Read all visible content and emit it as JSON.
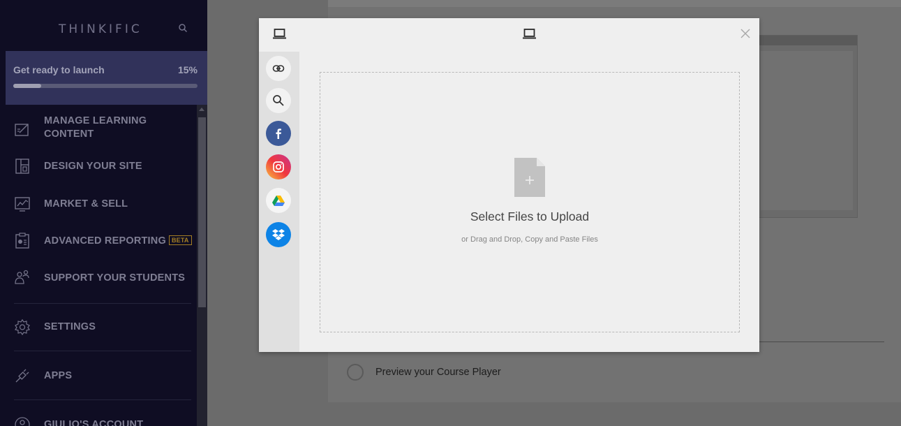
{
  "sidebar": {
    "logo": "THINKIFIC",
    "search_icon": "search-icon",
    "launch": {
      "label": "Get ready to launch",
      "percent_text": "15%",
      "progress": 0.15
    },
    "items": [
      {
        "label_line1": "MANAGE LEARNING",
        "label_line2": "CONTENT",
        "icon": "edit-icon"
      },
      {
        "label": "DESIGN YOUR SITE",
        "icon": "layout-icon"
      },
      {
        "label": "MARKET & SELL",
        "icon": "chart-icon"
      },
      {
        "label": "ADVANCED REPORTING",
        "badge": "BETA",
        "icon": "report-icon"
      },
      {
        "label": "SUPPORT YOUR STUDENTS",
        "icon": "students-icon"
      },
      {
        "label": "SETTINGS",
        "icon": "gear-icon"
      },
      {
        "label": "APPS",
        "icon": "plug-icon"
      },
      {
        "label": "GIULIO'S ACCOUNT",
        "icon": "account-icon"
      }
    ]
  },
  "background": {
    "preview_label": "Preview your Course Player"
  },
  "modal": {
    "header_icons": [
      "laptop-icon",
      "laptop-icon",
      "close-icon"
    ],
    "sources": [
      "link-icon",
      "search-icon",
      "facebook-icon",
      "instagram-icon",
      "google-drive-icon",
      "dropbox-icon"
    ],
    "dropzone": {
      "title": "Select Files to Upload",
      "subtitle": "or Drag and Drop, Copy and Paste Files"
    }
  },
  "colors": {
    "sidebar_bg": "#13112b",
    "launch_bg": "#3c3e6e",
    "facebook": "#3b5998",
    "dropbox": "#0d83e6",
    "beta_badge": "#c89a2c"
  }
}
